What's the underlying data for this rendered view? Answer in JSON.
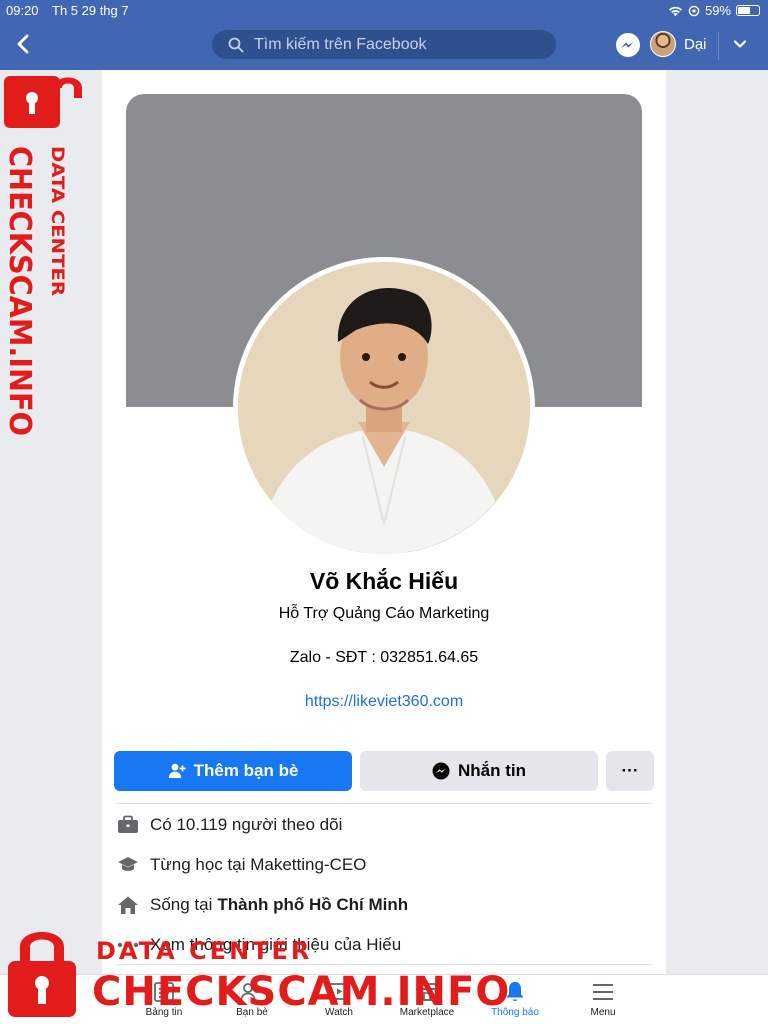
{
  "status_bar": {
    "time": "09:20",
    "date": "Th 5 29 thg 7",
    "battery": "59%",
    "battery_level": 0.59
  },
  "nav": {
    "search_placeholder": "Tìm kiếm trên Facebook",
    "user_name": "Dại"
  },
  "profile": {
    "name": "Võ Khắc Hiếu",
    "bio_line1": "Hỗ Trợ Quảng Cáo Marketing",
    "bio_line2": "Zalo - SĐT : 032851.64.65",
    "website": "https://likeviet360.com"
  },
  "actions": {
    "add_friend": "Thêm bạn bè",
    "message": "Nhắn tin",
    "more": "···"
  },
  "info": {
    "followers": "Có 10.119 người theo dõi",
    "education": "Từng học tại Maketting-CEO",
    "lives_prefix": "Sống tại",
    "lives_city": "Thành phố Hồ Chí Minh",
    "see_about": "Xem thông tin giới thiệu của Hiếu"
  },
  "tabs": [
    {
      "label": "Bảng tin",
      "icon": "newsfeed-icon",
      "active": false
    },
    {
      "label": "Bạn bè",
      "icon": "friends-icon",
      "active": false
    },
    {
      "label": "Watch",
      "icon": "watch-icon",
      "active": false
    },
    {
      "label": "Marketplace",
      "icon": "marketplace-icon",
      "active": false
    },
    {
      "label": "Thông báo",
      "icon": "bell-icon",
      "active": true
    },
    {
      "label": "Menu",
      "icon": "menu-icon",
      "active": false
    }
  ],
  "watermark": {
    "line1": "DATA CENTER",
    "line2": "CHECKSCAM.INFO"
  },
  "colors": {
    "facebook_blue": "#4267b2",
    "button_blue": "#1877f2",
    "watermark_red": "#e21b1b",
    "cover_gray": "#8b8d91"
  }
}
